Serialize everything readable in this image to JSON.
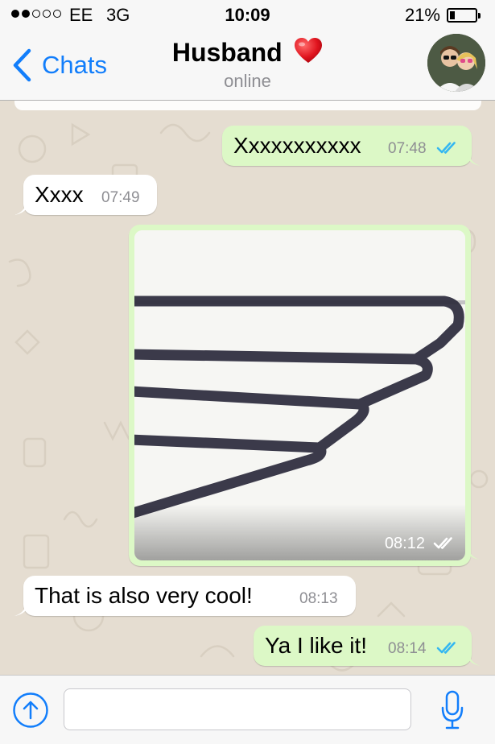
{
  "status_bar": {
    "signal_bars_filled": 2,
    "signal_bars_total": 5,
    "carrier": "EE",
    "network": "3G",
    "time": "10:09",
    "battery_percent_label": "21%",
    "battery_level": 0.21
  },
  "nav": {
    "back_label": "Chats",
    "contact_name": "Husband",
    "contact_status": "online",
    "title_icon": "red-heart-icon"
  },
  "messages": [
    {
      "direction": "out",
      "text": "Xxxxxxxxxxx",
      "time": "07:48",
      "status": "read"
    },
    {
      "direction": "in",
      "text": "Xxxx",
      "time": "07:49"
    },
    {
      "direction": "out",
      "type": "image",
      "time": "08:12",
      "status": "delivered"
    },
    {
      "direction": "in",
      "text": "That is also very cool!",
      "time": "08:13"
    },
    {
      "direction": "out",
      "text": "Ya I like it!",
      "time": "08:14",
      "status": "read"
    }
  ],
  "input": {
    "value": "",
    "attach_icon": "upload-arrow-icon",
    "mic_icon": "microphone-icon"
  },
  "colors": {
    "accent": "#127efb",
    "outgoing_bubble": "#dcf8c6",
    "incoming_bubble": "#ffffff",
    "read_ticks": "#34b7f1",
    "wallpaper": "#e5ddd1"
  }
}
